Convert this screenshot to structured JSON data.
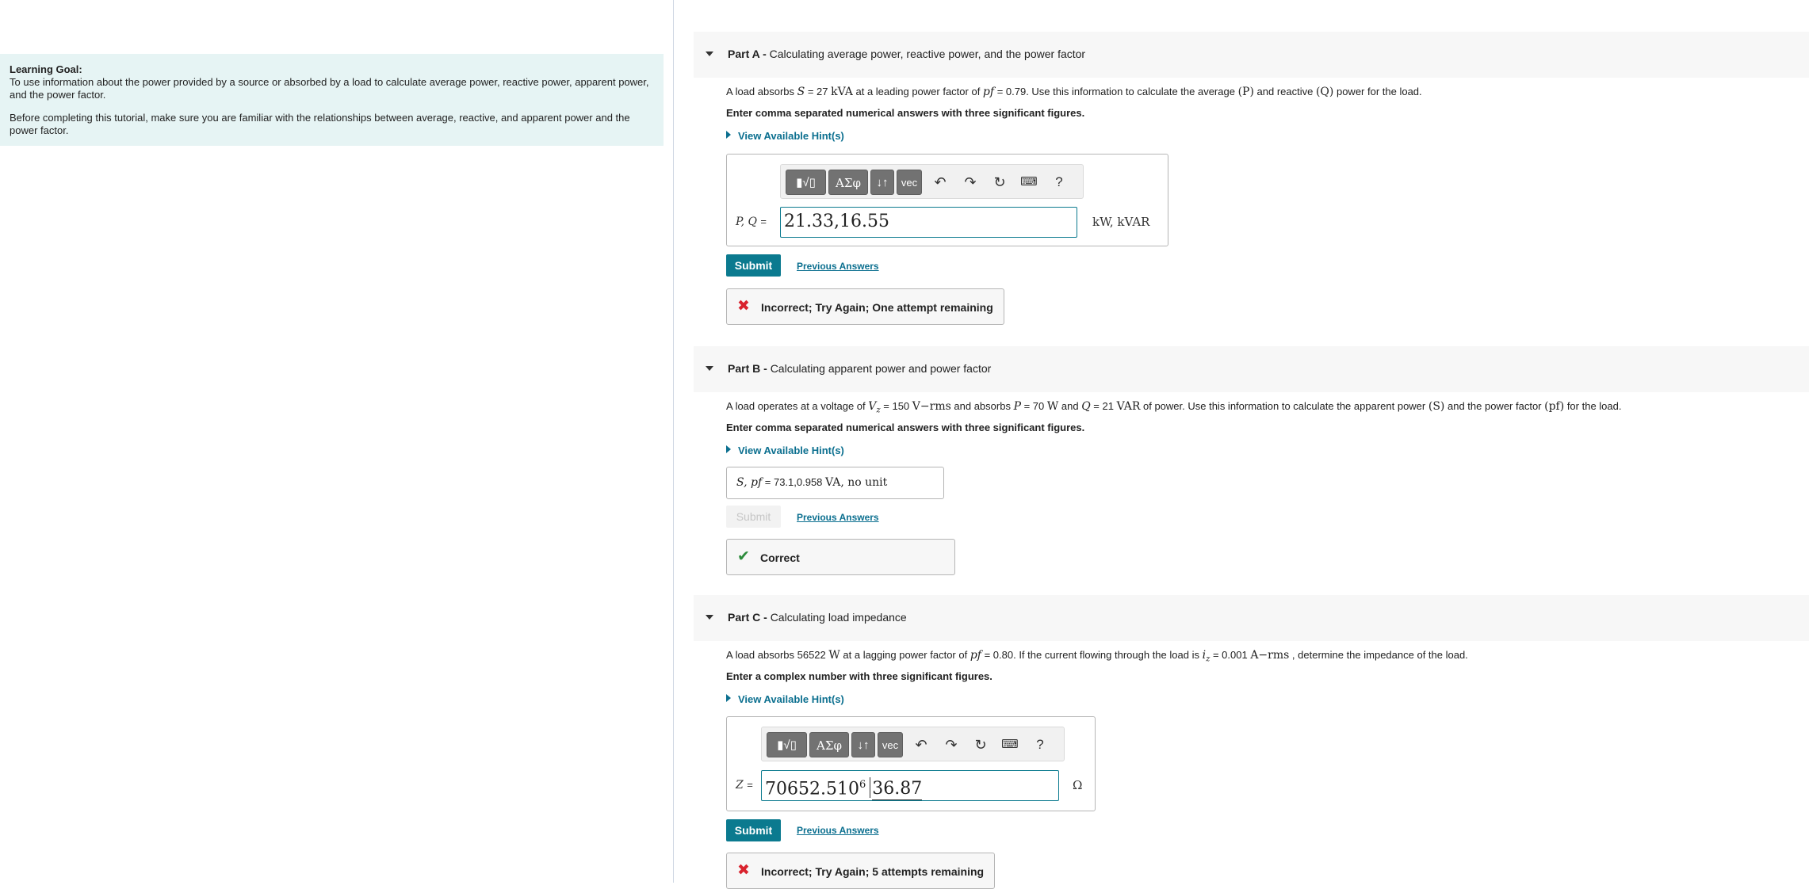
{
  "learning_goal": {
    "title": "Learning Goal:",
    "line1": "To use information about the power provided by a source or absorbed by a load to calculate  average power, reactive power, apparent power,",
    "line2": "and the power factor.",
    "line3": "Before completing this tutorial, make sure you are familiar with the relationships between average, reactive, and apparent power and the",
    "line4": "power factor."
  },
  "common": {
    "instructions_numeric": "Enter comma separated numerical answers with three significant figures.",
    "instructions_complex": "Enter a complex number with three significant figures.",
    "hint_label": "View Available Hint(s)",
    "submit_label": "Submit",
    "previous_answers_label": "Previous Answers",
    "toolbar": {
      "greek": "ΑΣφ",
      "arrows": "↓↑",
      "vec": "vec",
      "help": "?"
    }
  },
  "partA": {
    "label": "Part A -",
    "title": "Calculating average power, reactive power, and the power factor",
    "q_pre": "A load absorbs ",
    "q_S": "S",
    "q_S_val": " = 27 ",
    "q_S_unit": "kVA",
    "q_mid": " at a leading power factor of ",
    "q_pf": "pf",
    "q_pf_val": " = 0.79. Use this information to calculate the average ",
    "q_P": "(P)",
    "q_and": " and reactive ",
    "q_Q": "(Q)",
    "q_end": " power for the load.",
    "answer_prefix": "P, Q",
    "answer_value": "21.33,16.55",
    "units": "kW, kVAR",
    "feedback": "Incorrect; Try Again; One attempt remaining"
  },
  "partB": {
    "label": "Part B -",
    "title": "Calculating apparent power and power factor",
    "q_pre": "A load operates at a voltage of ",
    "q_V": "V",
    "q_V_sub": "z",
    "q_V_val": " = 150 ",
    "q_V_unit": "V−rms",
    "q_mid1": " and absorbs ",
    "q_P": "P",
    "q_P_val": " = 70 ",
    "q_P_unit": "W",
    "q_mid2": " and ",
    "q_Q": "Q",
    "q_Q_val": " = 21 ",
    "q_Q_unit": "VAR",
    "q_end1": " of power. Use this information to calculate the apparent power ",
    "q_S": "(S)",
    "q_end2": " and the power factor ",
    "q_pf": "(pf)",
    "q_end3": " for the load.",
    "answer_prefix": "S, pf",
    "answer_value": "73.1,0.958",
    "units": "VA, no unit",
    "feedback": "Correct"
  },
  "partC": {
    "label": "Part C -",
    "title": "Calculating load impedance",
    "q_pre": "A load absorbs 56522 ",
    "q_unit_W": "W",
    "q_mid": "  at a lagging power factor of ",
    "q_pf": "pf",
    "q_pf_val": " = 0.80. If the current flowing through the load is ",
    "q_i": "i",
    "q_i_sub": "z",
    "q_i_val": " = 0.001 ",
    "q_i_unit": "A−rms",
    "q_end": " , determine the impedance of the load.",
    "answer_prefix": "Z",
    "answer_mantissa": "70652.510",
    "answer_exp": "6",
    "answer_angle": "36.87",
    "units": "Ω",
    "feedback": "Incorrect; Try Again; 5 attempts remaining"
  },
  "colors": {
    "accent": "#0b7a8f",
    "goal_bg": "#e6f4f4",
    "error": "#d9232e",
    "success": "#2c8b3b"
  }
}
